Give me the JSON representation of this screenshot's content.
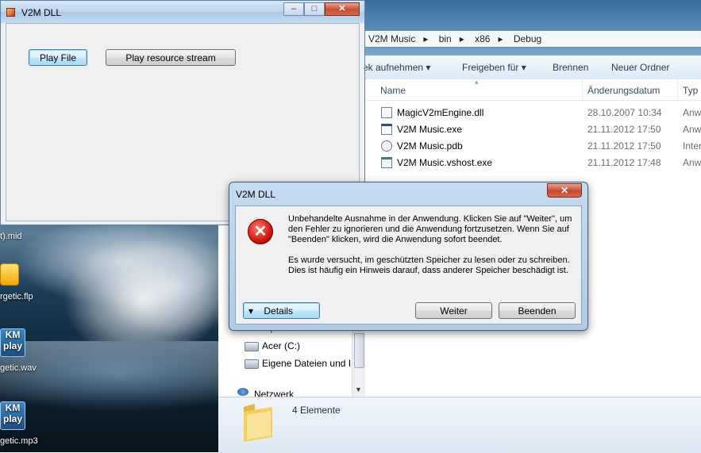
{
  "main_window": {
    "title": "V2M DLL",
    "buttons": {
      "play_file": "Play File",
      "play_resource": "Play resource stream"
    }
  },
  "desktop": {
    "icons": [
      {
        "label": "t).mid"
      },
      {
        "label": "rgetic.flp"
      },
      {
        "label": "getic.wav",
        "badge": "KM play"
      },
      {
        "label": "getic.mp3",
        "badge": "KM play"
      }
    ]
  },
  "explorer": {
    "breadcrumb": [
      "V2M Music",
      "bin",
      "x86",
      "Debug"
    ],
    "toolbar": [
      "ek aufnehmen",
      "Freigeben für",
      "Brennen",
      "Neuer Ordner"
    ],
    "columns": {
      "name": "Name",
      "date": "Änderungsdatum",
      "type": "Typ"
    },
    "files": [
      {
        "name": "MagicV2mEngine.dll",
        "date": "28.10.2007 10:34",
        "type": "Anw"
      },
      {
        "name": "V2M Music.exe",
        "date": "21.11.2012 17:50",
        "type": "Anw"
      },
      {
        "name": "V2M Music.pdb",
        "date": "21.11.2012 17:50",
        "type": "Inter"
      },
      {
        "name": "V2M Music.vshost.exe",
        "date": "21.11.2012 17:48",
        "type": "Anw"
      }
    ],
    "nav": {
      "computer": "Computer",
      "drive_c": "Acer (C:)",
      "drive_data": "Eigene Dateien und Ir",
      "network": "Netzwerk"
    },
    "status": "4 Elemente"
  },
  "dialog": {
    "title": "V2M DLL",
    "message1": "Unbehandelte Ausnahme in der Anwendung. Klicken Sie auf \"Weiter\", um den Fehler zu ignorieren und die Anwendung fortzusetzen. Wenn Sie auf \"Beenden\" klicken, wird die Anwendung sofort beendet.",
    "message2": "Es wurde versucht, im geschützten Speicher zu lesen oder zu schreiben. Dies ist häufig ein Hinweis darauf, dass anderer Speicher beschädigt ist.",
    "buttons": {
      "details": "Details",
      "continue": "Weiter",
      "quit": "Beenden"
    }
  }
}
